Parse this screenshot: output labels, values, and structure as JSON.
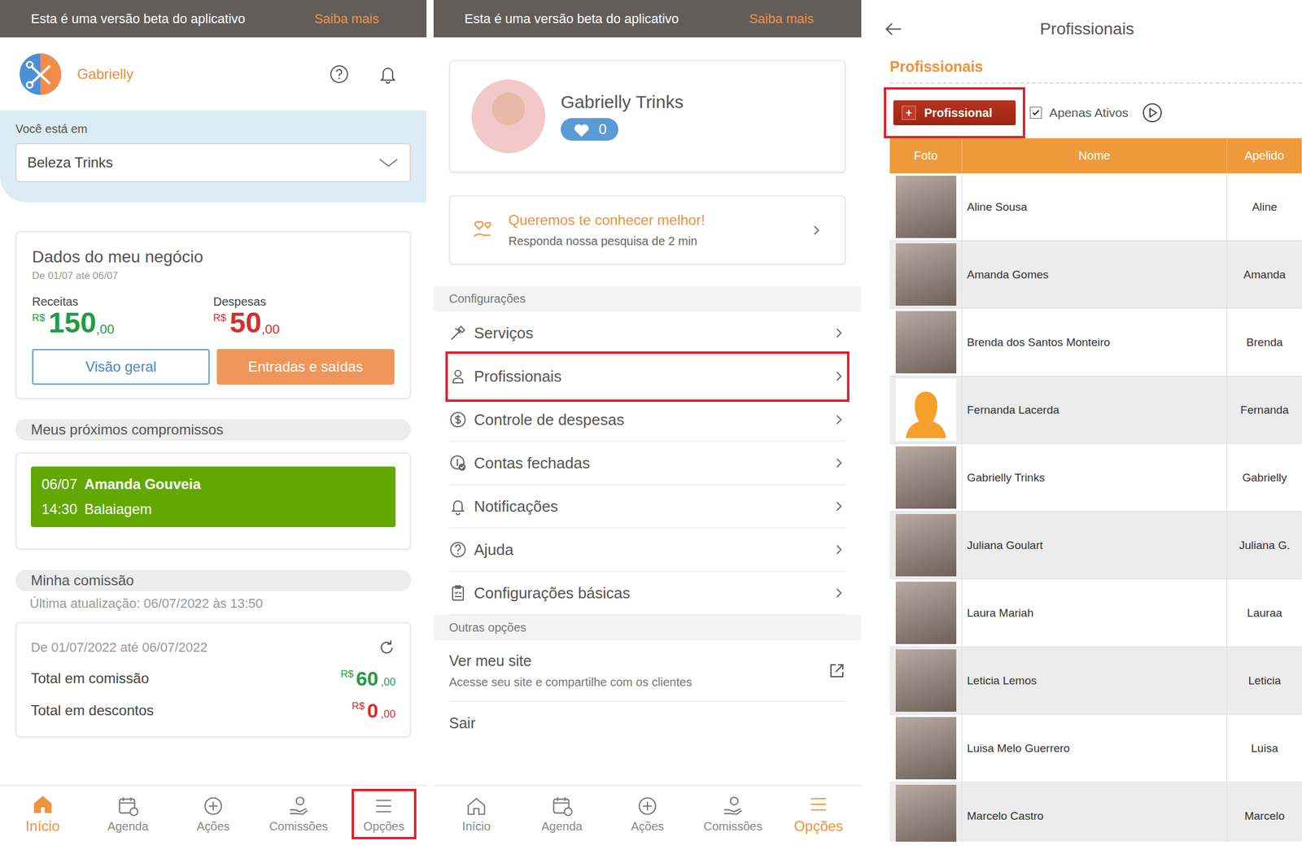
{
  "beta_banner": {
    "text": "Esta é uma versão beta do aplicativo",
    "link": "Saiba mais"
  },
  "home": {
    "user_name": "Gabrielly",
    "location": {
      "label": "Você está em",
      "value": "Beleza Trinks"
    },
    "business": {
      "title": "Dados do meu negócio",
      "period": "De 01/07 até 06/07",
      "figures": [
        {
          "label": "Receitas",
          "currency": "R$",
          "value": "150",
          "cents": ",00",
          "color": "#1f9d45"
        },
        {
          "label": "Despesas",
          "currency": "R$",
          "value": "50",
          "cents": ",00",
          "color": "#d32f2f"
        }
      ],
      "buttons": [
        {
          "label": "Visão geral",
          "kind": "outline"
        },
        {
          "label": "Entradas e saídas",
          "kind": "filled"
        }
      ]
    },
    "appointments": {
      "title": "Meus próximos compromissos",
      "items": [
        {
          "date": "06/07",
          "client": "Amanda Gouveia",
          "time": "14:30",
          "service": "Balaiagem",
          "color": "#62a800"
        }
      ]
    },
    "commission": {
      "title": "Minha comissão",
      "updated": "Última atualização: 06/07/2022 às 13:50",
      "period": "De 01/07/2022 até 06/07/2022",
      "rows": [
        {
          "label": "Total em comissão",
          "currency": "R$",
          "value": "60",
          "cents": ",00",
          "color": "#1f9d45"
        },
        {
          "label": "Total em descontos",
          "currency": "R$",
          "value": "0",
          "cents": ",00",
          "color": "#d32f2f"
        }
      ]
    },
    "nav": [
      {
        "label": "Início",
        "selected": true,
        "highlighted": false
      },
      {
        "label": "Agenda",
        "selected": false,
        "highlighted": false
      },
      {
        "label": "Ações",
        "selected": false,
        "highlighted": false
      },
      {
        "label": "Comissões",
        "selected": false,
        "highlighted": false
      },
      {
        "label": "Opções",
        "selected": false,
        "highlighted": true
      }
    ]
  },
  "options": {
    "profile": {
      "name": "Gabrielly Trinks",
      "likes": "0"
    },
    "survey": {
      "title": "Queremos te conhecer melhor!",
      "subtitle": "Responda nossa pesquisa de 2 min"
    },
    "settings": {
      "title": "Configurações",
      "items": [
        {
          "label": "Serviços",
          "highlighted": false
        },
        {
          "label": "Profissionais",
          "highlighted": true
        },
        {
          "label": "Controle de despesas",
          "highlighted": false
        },
        {
          "label": "Contas fechadas",
          "highlighted": false
        },
        {
          "label": "Notificações",
          "highlighted": false
        },
        {
          "label": "Ajuda",
          "highlighted": false
        },
        {
          "label": "Configurações básicas",
          "highlighted": false
        }
      ]
    },
    "other": {
      "title": "Outras opções",
      "site": {
        "title": "Ver meu site",
        "subtitle": "Acesse seu site e compartilhe com os clientes"
      },
      "logout": "Sair"
    },
    "nav": [
      {
        "label": "Início",
        "selected": false,
        "highlighted": false
      },
      {
        "label": "Agenda",
        "selected": false,
        "highlighted": false
      },
      {
        "label": "Ações",
        "selected": false,
        "highlighted": false
      },
      {
        "label": "Comissões",
        "selected": false,
        "highlighted": false
      },
      {
        "label": "Opções",
        "selected": true,
        "highlighted": false
      }
    ]
  },
  "professionals": {
    "title": "Profissionais",
    "section_title": "Profissionais",
    "add_button": {
      "icon": "+",
      "label": "Profissional",
      "highlighted": true
    },
    "active_only": {
      "label": "Apenas Ativos",
      "checked": true
    },
    "columns": [
      "Foto",
      "Nome",
      "Apelido"
    ],
    "rows": [
      {
        "name": "Aline Sousa",
        "nickname": "Aline",
        "kind": "photo"
      },
      {
        "name": "Amanda Gomes",
        "nickname": "Amanda",
        "kind": "photo"
      },
      {
        "name": "Brenda dos Santos Monteiro",
        "nickname": "Brenda",
        "kind": "photo"
      },
      {
        "name": "Fernanda Lacerda",
        "nickname": "Fernanda",
        "kind": "placeholder"
      },
      {
        "name": "Gabrielly Trinks",
        "nickname": "Gabrielly",
        "kind": "photo"
      },
      {
        "name": "Juliana Goulart",
        "nickname": "Juliana G.",
        "kind": "photo"
      },
      {
        "name": "Laura Mariah",
        "nickname": "Lauraa",
        "kind": "photo"
      },
      {
        "name": "Leticia Lemos",
        "nickname": "Leticia",
        "kind": "photo"
      },
      {
        "name": "Luisa Melo Guerrero",
        "nickname": "Luisa",
        "kind": "photo"
      },
      {
        "name": "Marcelo Castro",
        "nickname": "Marcelo",
        "kind": "photo"
      }
    ]
  }
}
